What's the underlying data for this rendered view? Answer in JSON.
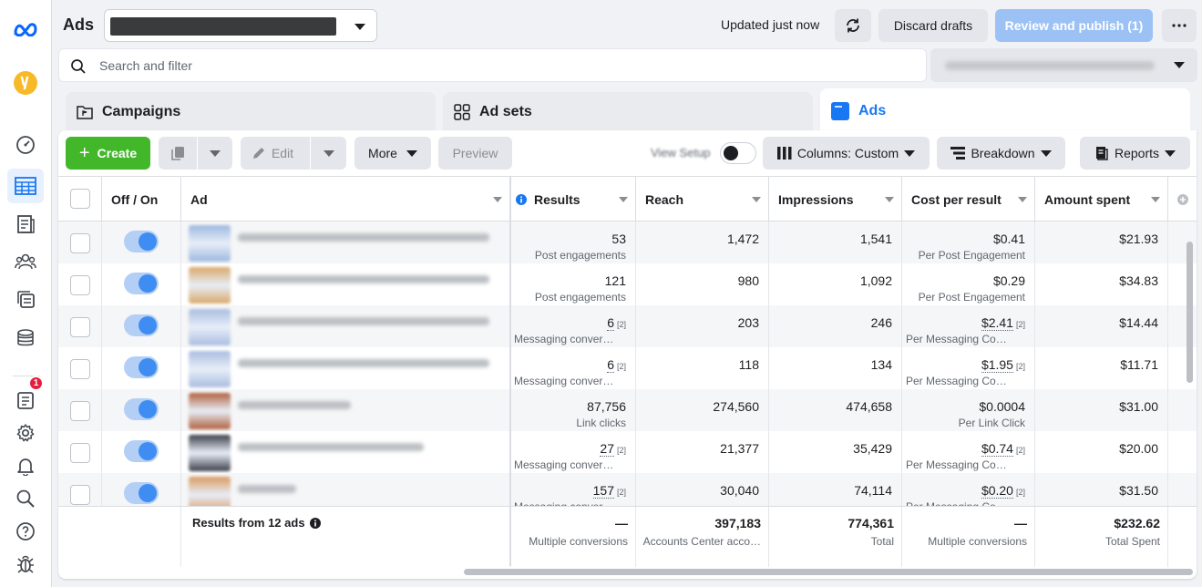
{
  "app": {
    "title": "Ads"
  },
  "topbar": {
    "updated": "Updated just now",
    "discard_label": "Discard drafts",
    "publish_label": "Review and publish (1)"
  },
  "search": {
    "placeholder": "Search and filter"
  },
  "level_tabs": [
    {
      "label": "Campaigns"
    },
    {
      "label": "Ad sets"
    },
    {
      "label": "Ads"
    }
  ],
  "toolbar": {
    "create_label": "Create",
    "edit_label": "Edit",
    "more_label": "More",
    "preview_label": "Preview",
    "view_setup_label": "View Setup",
    "columns_label": "Columns: Custom",
    "breakdown_label": "Breakdown",
    "reports_label": "Reports"
  },
  "table": {
    "columns": [
      "Off / On",
      "Ad",
      "Results",
      "Reach",
      "Impressions",
      "Cost per result",
      "Amount spent"
    ],
    "rows": [
      {
        "results": "53",
        "results_fn": "",
        "results_sub": "Post engagements",
        "reach": "1,472",
        "impressions": "1,541",
        "cost": "$0.41",
        "cost_fn": "",
        "cost_sub": "Per Post Engagement",
        "spent": "$21.93"
      },
      {
        "results": "121",
        "results_fn": "",
        "results_sub": "Post engagements",
        "reach": "980",
        "impressions": "1,092",
        "cost": "$0.29",
        "cost_fn": "",
        "cost_sub": "Per Post Engagement",
        "spent": "$34.83"
      },
      {
        "results": "6",
        "results_fn": "[2]",
        "results_sub": "Messaging conver…",
        "reach": "203",
        "impressions": "246",
        "cost": "$2.41",
        "cost_fn": "[2]",
        "cost_sub": "Per Messaging Co…",
        "spent": "$14.44"
      },
      {
        "results": "6",
        "results_fn": "[2]",
        "results_sub": "Messaging conver…",
        "reach": "118",
        "impressions": "134",
        "cost": "$1.95",
        "cost_fn": "[2]",
        "cost_sub": "Per Messaging Co…",
        "spent": "$11.71"
      },
      {
        "results": "87,756",
        "results_fn": "",
        "results_sub": "Link clicks",
        "reach": "274,560",
        "impressions": "474,658",
        "cost": "$0.0004",
        "cost_fn": "",
        "cost_sub": "Per Link Click",
        "spent": "$31.00"
      },
      {
        "results": "27",
        "results_fn": "[2]",
        "results_sub": "Messaging conver…",
        "reach": "21,377",
        "impressions": "35,429",
        "cost": "$0.74",
        "cost_fn": "[2]",
        "cost_sub": "Per Messaging Co…",
        "spent": "$20.00"
      },
      {
        "results": "157",
        "results_fn": "[2]",
        "results_sub": "Messaging conver…",
        "reach": "30,040",
        "impressions": "74,114",
        "cost": "$0.20",
        "cost_fn": "[2]",
        "cost_sub": "Per Messaging Co…",
        "spent": "$31.50"
      }
    ],
    "footer": {
      "label": "Results from 12 ads",
      "results": "—",
      "results_sub": "Multiple conversions",
      "reach": "397,183",
      "reach_sub": "Accounts Center acco…",
      "impressions": "774,361",
      "impressions_sub": "Total",
      "cost": "—",
      "cost_sub": "Multiple conversions",
      "spent": "$232.62",
      "spent_sub": "Total Spent"
    }
  },
  "rail": {
    "notification_count": "1"
  },
  "colors": {
    "brand_blue": "#1877f2",
    "create_green": "#42b72a",
    "publish_disabled": "#9cc2f5"
  }
}
